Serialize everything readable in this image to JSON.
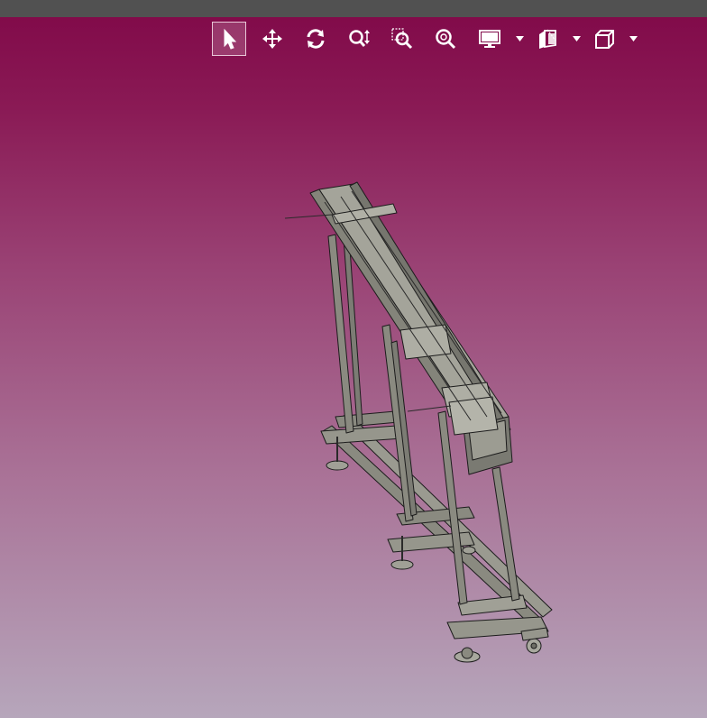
{
  "toolbar": {
    "tools": [
      {
        "icon": "select-arrow-icon",
        "active": true
      },
      {
        "icon": "pan-move-icon",
        "active": false
      },
      {
        "icon": "rotate-icon",
        "active": false
      },
      {
        "icon": "zoom-icon",
        "active": false
      },
      {
        "icon": "zoom-window-icon",
        "active": false
      },
      {
        "icon": "fit-all-icon",
        "active": false
      },
      {
        "icon": "display-mode-icon",
        "active": false,
        "has_dropdown": true
      },
      {
        "icon": "section-cut-icon",
        "active": false,
        "has_dropdown": true
      },
      {
        "icon": "view-cube-icon",
        "active": false,
        "has_dropdown": true
      }
    ]
  },
  "colors": {
    "title_bar": "#515151",
    "background_top": "#800848",
    "background_bottom": "#b6a6bb",
    "icon": "#ffffff",
    "model_fill": "#8a8a80",
    "model_edge": "#1c1c1c"
  },
  "viewport": {
    "model": "conveyor-frame-assembly"
  }
}
